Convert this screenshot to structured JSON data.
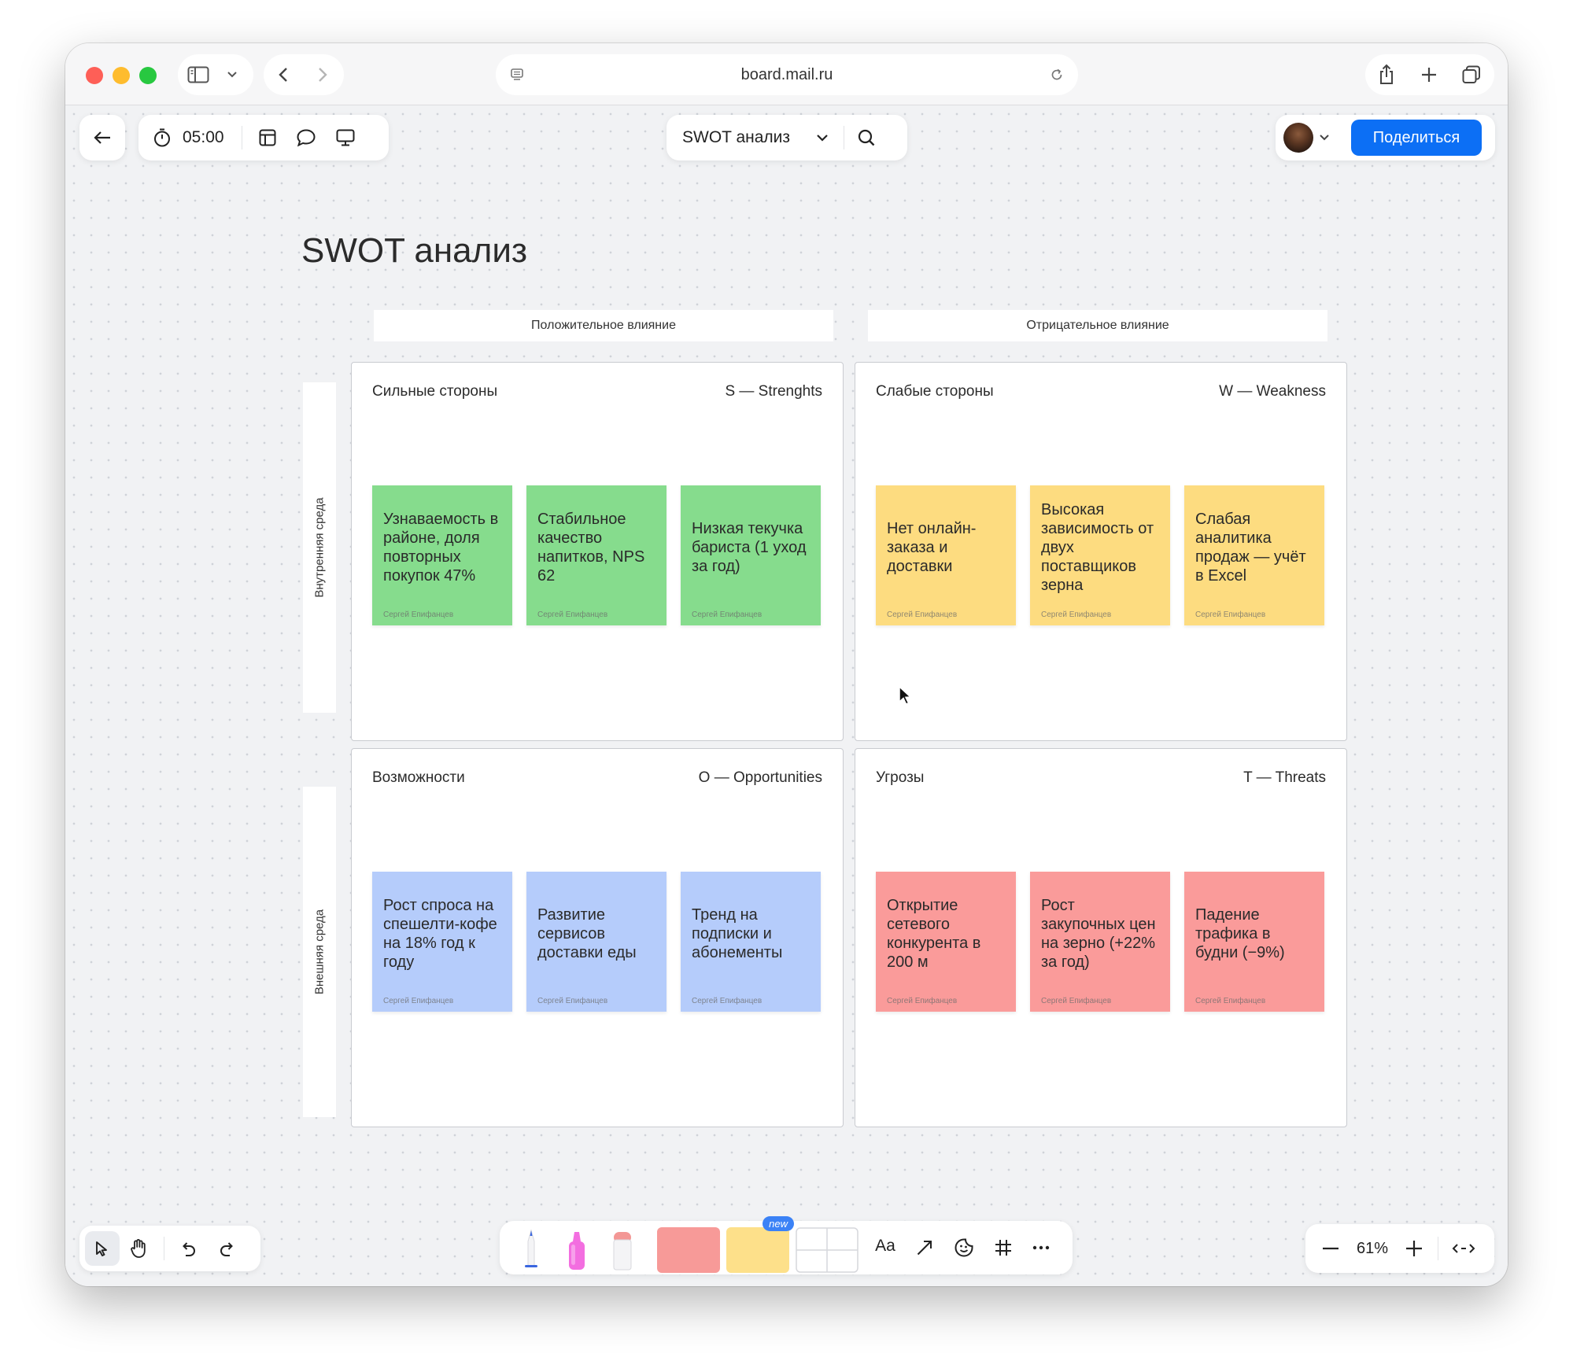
{
  "browser": {
    "url": "board.mail.ru"
  },
  "toolbar": {
    "timer": "05:00",
    "board_name": "SWOT анализ",
    "share_label": "Поделиться"
  },
  "board": {
    "title": "SWOT анализ",
    "col_headers": [
      "Положительное влияние",
      "Отрицательное влияние"
    ],
    "row_headers": [
      "Внутренняя среда",
      "Внешняя среда"
    ],
    "quadrants": [
      {
        "title": "Сильные стороны",
        "code": "S — Strenghts",
        "color": "#86dc8d",
        "notes": [
          {
            "text": "Узнаваемость в районе, доля повторных покупок 47%",
            "author": "Сергей Епифанцев"
          },
          {
            "text": "Стабильное качество напитков, NPS 62",
            "author": "Сергей Епифанцев"
          },
          {
            "text": "Низкая текучка бариста (1 уход за год)",
            "author": "Сергей Епифанцев"
          }
        ]
      },
      {
        "title": "Слабые стороны",
        "code": "W — Weakness",
        "color": "#fddc80",
        "notes": [
          {
            "text": "Нет онлайн-заказа и доставки",
            "author": "Сергей Епифанцев"
          },
          {
            "text": "Высокая зависимость от двух поставщиков зерна",
            "author": "Сергей Епифанцев"
          },
          {
            "text": "Слабая аналитика продаж — учёт в Excel",
            "author": "Сергей Епифанцев"
          }
        ]
      },
      {
        "title": "Возможности",
        "code": "O — Opportunities",
        "color": "#b5ccfb",
        "notes": [
          {
            "text": "Рост спроса на спешелти-кофе на 18% год к году",
            "author": "Сергей Епифанцев"
          },
          {
            "text": "Развитие сервисов доставки еды",
            "author": "Сергей Епифанцев"
          },
          {
            "text": "Тренд на подписки и абонементы",
            "author": "Сергей Епифанцев"
          }
        ]
      },
      {
        "title": "Угрозы",
        "code": "T — Threats",
        "color": "#fa9b9a",
        "notes": [
          {
            "text": "Открытие сетевого конкурента в 200 м",
            "author": "Сергей Епифанцев"
          },
          {
            "text": "Рост закупочных цен на зерно (+22% за год)",
            "author": "Сергей Епифанцев"
          },
          {
            "text": "Падение трафика в будни (−9%)",
            "author": "Сергей Епифанцев"
          }
        ]
      }
    ]
  },
  "bottom_toolbar": {
    "text_tool": "Aa",
    "new_badge": "new"
  },
  "zoom": {
    "level": "61%"
  },
  "icons": [
    "sidebar-icon",
    "chevron-down-icon",
    "back-arrow-icon",
    "forward-arrow-icon",
    "reader-icon",
    "reload-icon",
    "share-icon",
    "new-tab-icon",
    "tabs-overview-icon",
    "timer-icon",
    "layout-icon",
    "comment-icon",
    "presentation-icon",
    "search-icon",
    "cursor-icon",
    "hand-icon",
    "undo-icon",
    "redo-icon",
    "pen-icon",
    "marker-icon",
    "eraser-icon",
    "arrow-icon",
    "sticker-icon",
    "frame-icon",
    "more-icon",
    "minus-icon",
    "plus-icon",
    "fit-width-icon"
  ]
}
